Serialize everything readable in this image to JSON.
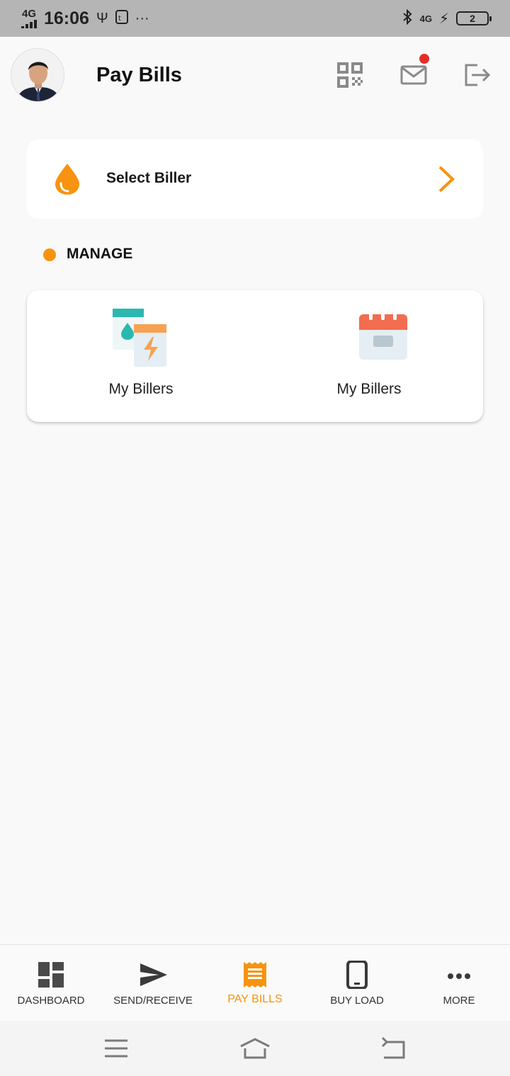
{
  "status_bar": {
    "network_left": "4G",
    "time": "16:06",
    "usb_glyph": "Ψ",
    "more_glyph": "···",
    "bluetooth_glyph": "✱",
    "network_right": "4G",
    "charging_glyph": "⚡",
    "battery_level": "2"
  },
  "header": {
    "title": "Pay Bills",
    "icons": [
      "qr-code-icon",
      "mail-icon",
      "logout-icon"
    ],
    "has_notification": true
  },
  "biller": {
    "label": "Select Biller",
    "icon": "water-drop-icon"
  },
  "manage": {
    "heading": "MANAGE",
    "items": [
      {
        "label": "My Billers",
        "icon": "billers-icon"
      },
      {
        "label": "My Billers",
        "icon": "calendar-icon"
      }
    ]
  },
  "bottom_nav": {
    "items": [
      {
        "label": "DASHBOARD",
        "icon": "dashboard-icon",
        "active": false
      },
      {
        "label": "SEND/RECEIVE",
        "icon": "send-icon",
        "active": false
      },
      {
        "label": "PAY BILLS",
        "icon": "receipt-icon",
        "active": true
      },
      {
        "label": "BUY LOAD",
        "icon": "phone-icon",
        "active": false
      },
      {
        "label": "MORE",
        "icon": "more-icon",
        "active": false
      }
    ]
  },
  "colors": {
    "accent": "#f7930e",
    "teal": "#2bb8b0",
    "notification": "#e52d27",
    "status_bar": "#b5b5b5"
  }
}
